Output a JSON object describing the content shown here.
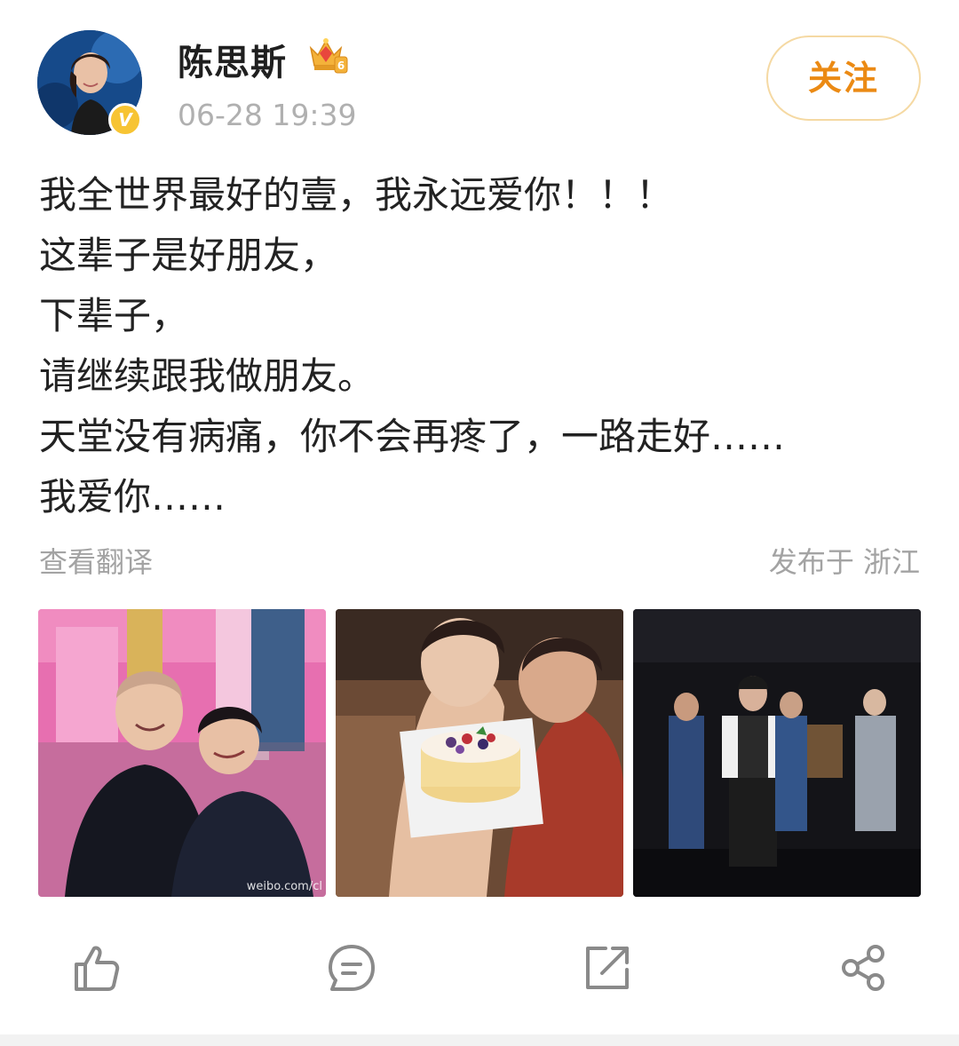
{
  "author": {
    "name": "陈思斯",
    "timestamp": "06-28 19:39",
    "verified_badge": "V",
    "member_level": "6",
    "avatar": "avatar"
  },
  "follow_button": {
    "label": "关注"
  },
  "post": {
    "lines": [
      "我全世界最好的壹，我永远爱你！！！",
      "这辈子是好朋友，",
      "下辈子，",
      "请继续跟我做朋友。",
      "天堂没有病痛，你不会再疼了，一路走好……",
      "我爱你……"
    ],
    "translate_label": "查看翻译",
    "location": "发布于 浙江"
  },
  "images": [
    {
      "name": "photo-two-women-embracing",
      "watermark": "weibo.com/cl"
    },
    {
      "name": "photo-birthday-cake"
    },
    {
      "name": "photo-stage-performance"
    }
  ],
  "actions": [
    {
      "icon": "thumbs-up-icon"
    },
    {
      "icon": "comment-icon"
    },
    {
      "icon": "repost-icon"
    },
    {
      "icon": "share-icon"
    }
  ],
  "colors": {
    "follow_text": "#eb8a14",
    "follow_border": "#f5d9a3",
    "verified_badge": "#f7c433",
    "muted_text": "#b0b0b0",
    "icon_gray": "#8a8a8a"
  }
}
